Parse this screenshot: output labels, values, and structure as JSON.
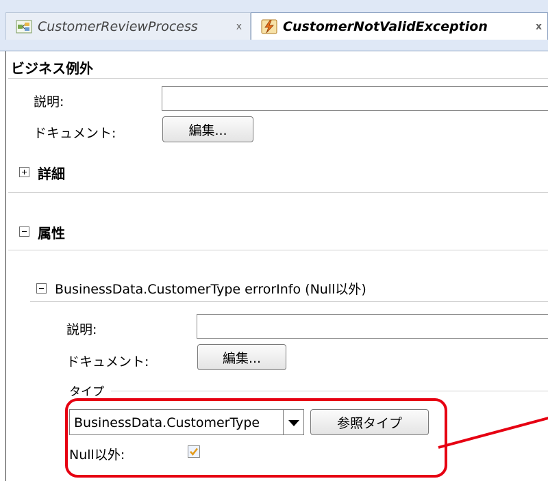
{
  "tabs": [
    {
      "label": "CustomerReviewProcess",
      "close": "x"
    },
    {
      "label": "CustomerNotValidException",
      "close": "x"
    }
  ],
  "business_exception": {
    "title": "ビジネス例外",
    "description_label": "説明:",
    "description_value": "",
    "document_label": "ドキュメント:",
    "edit_button": "編集..."
  },
  "details": {
    "title": "詳細"
  },
  "attributes": {
    "title": "属性",
    "item": {
      "header": "BusinessData.CustomerType errorInfo (Null以外)",
      "description_label": "説明:",
      "description_value": "",
      "document_label": "ドキュメント:",
      "edit_button": "編集...",
      "type_group_label": "タイプ",
      "type_value": "BusinessData.CustomerType",
      "browse_type_button": "参照タイプ",
      "not_null_label": "Null以外:",
      "not_null_checked": true
    }
  },
  "colors": {
    "highlight": "#e60012",
    "tab_bar": "#dfe8f6"
  }
}
